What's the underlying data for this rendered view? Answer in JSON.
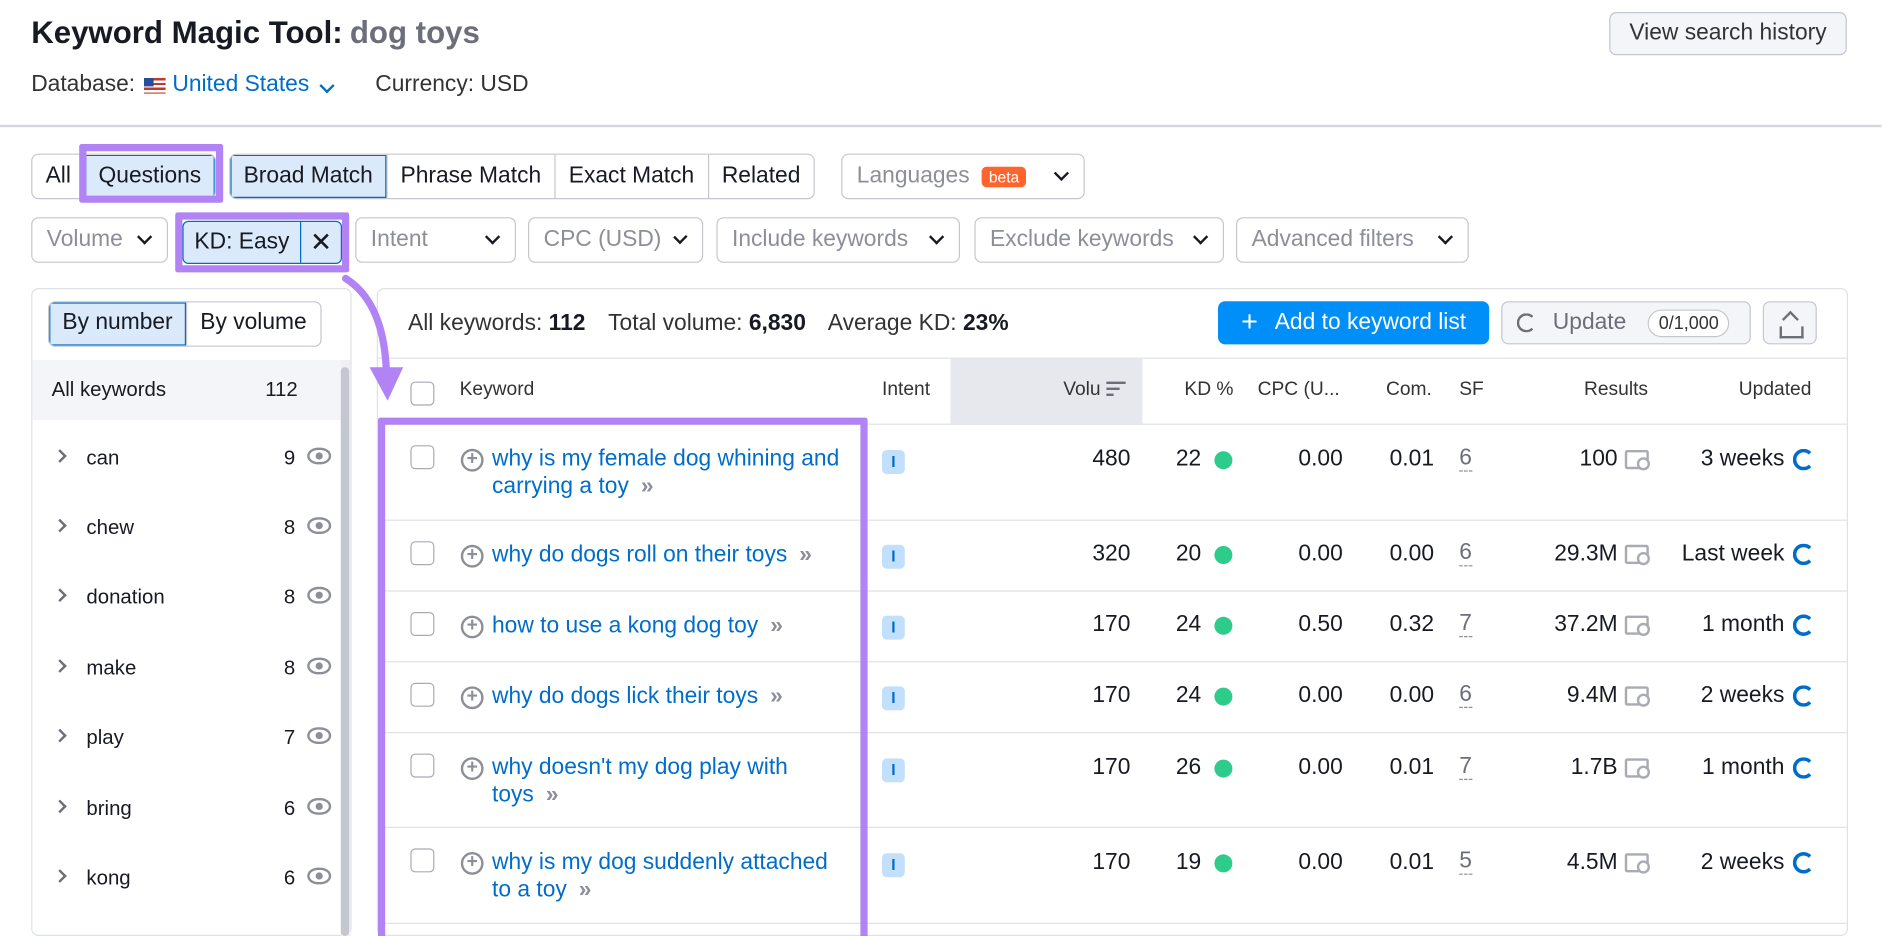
{
  "header": {
    "tool_title": "Keyword Magic Tool:",
    "query": "dog toys",
    "database_label": "Database:",
    "database_value": "United States",
    "currency": "Currency: USD",
    "history_button": "View search history"
  },
  "tabs_primary": [
    "All",
    "Questions"
  ],
  "tabs_match": [
    "Broad Match",
    "Phrase Match",
    "Exact Match",
    "Related"
  ],
  "languages": {
    "label": "Languages",
    "badge": "beta"
  },
  "filters": {
    "volume": "Volume",
    "kd": "KD: Easy",
    "kd_clear": "✕",
    "intent": "Intent",
    "cpc": "CPC (USD)",
    "include": "Include keywords",
    "exclude": "Exclude keywords",
    "advanced": "Advanced filters"
  },
  "groups_panel": {
    "by_number": "By number",
    "by_volume": "By volume",
    "all_label": "All keywords",
    "all_count": "112",
    "items": [
      {
        "name": "can",
        "count": "9"
      },
      {
        "name": "chew",
        "count": "8"
      },
      {
        "name": "donation",
        "count": "8"
      },
      {
        "name": "make",
        "count": "8"
      },
      {
        "name": "play",
        "count": "7"
      },
      {
        "name": "bring",
        "count": "6"
      },
      {
        "name": "kong",
        "count": "6"
      }
    ]
  },
  "summary": {
    "all_label": "All keywords:",
    "all_value": "112",
    "volume_label": "Total volume:",
    "volume_value": "6,830",
    "kd_label": "Average KD:",
    "kd_value": "23%"
  },
  "actions": {
    "add_plus": "+",
    "add": "Add to keyword list",
    "update": "Update",
    "update_count": "0/1,000"
  },
  "table": {
    "columns": {
      "keyword": "Keyword",
      "intent": "Intent",
      "volume": "Volu",
      "kd": "KD %",
      "cpc": "CPC (U...",
      "com": "Com.",
      "sf": "SF",
      "results": "Results",
      "updated": "Updated"
    },
    "rows": [
      {
        "keyword": "why is my female dog whining and carrying a toy",
        "intent": "I",
        "volume": "480",
        "kd": "22",
        "cpc": "0.00",
        "com": "0.01",
        "sf": "6",
        "results": "100",
        "updated": "3 weeks"
      },
      {
        "keyword": "why do dogs roll on their toys",
        "intent": "I",
        "volume": "320",
        "kd": "20",
        "cpc": "0.00",
        "com": "0.00",
        "sf": "6",
        "results": "29.3M",
        "updated": "Last week"
      },
      {
        "keyword": "how to use a kong dog toy",
        "intent": "I",
        "volume": "170",
        "kd": "24",
        "cpc": "0.50",
        "com": "0.32",
        "sf": "7",
        "results": "37.2M",
        "updated": "1 month"
      },
      {
        "keyword": "why do dogs lick their toys",
        "intent": "I",
        "volume": "170",
        "kd": "24",
        "cpc": "0.00",
        "com": "0.00",
        "sf": "6",
        "results": "9.4M",
        "updated": "2 weeks"
      },
      {
        "keyword": "why doesn't my dog play with toys",
        "intent": "I",
        "volume": "170",
        "kd": "26",
        "cpc": "0.00",
        "com": "0.01",
        "sf": "7",
        "results": "1.7B",
        "updated": "1 month"
      },
      {
        "keyword": "why is my dog suddenly attached to a toy",
        "intent": "I",
        "volume": "170",
        "kd": "19",
        "cpc": "0.00",
        "com": "0.01",
        "sf": "5",
        "results": "4.5M",
        "updated": "2 weeks"
      }
    ]
  },
  "colors": {
    "accent": "#006dca",
    "highlight": "#b183f4",
    "kd_easy": "#2ecc8a",
    "primary_button": "#008ff8"
  }
}
